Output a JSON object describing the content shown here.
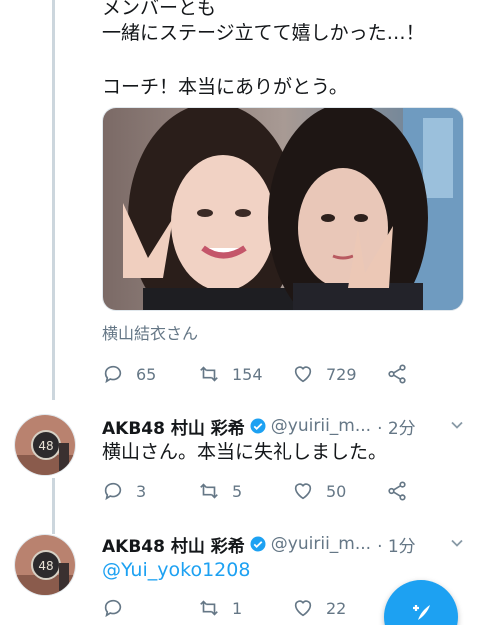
{
  "main_tweet": {
    "lines": [
      "メンバーとも",
      "一緒にステージ立てて嬉しかった…！",
      "",
      "コーチ！本当にありがとう。"
    ],
    "photo_tag": "横山結衣さん",
    "counts": {
      "reply": "65",
      "retweet": "154",
      "like": "729"
    }
  },
  "reply1": {
    "name": "AKB48 村山 彩希",
    "handle": "@yuirii_m...",
    "time": "· 2分",
    "text": "横山さん。本当に失礼しました。",
    "counts": {
      "reply": "3",
      "retweet": "5",
      "like": "50"
    }
  },
  "reply2": {
    "name": "AKB48 村山 彩希",
    "handle": "@yuirii_m...",
    "time": "· 1分",
    "text": "@Yui_yoko1208",
    "counts": {
      "reply": "",
      "retweet": "1",
      "like": "22"
    }
  },
  "colors": {
    "accent": "#1da1f2",
    "muted": "#657786",
    "thread": "#ccd6dd"
  },
  "icons": [
    "reply-icon",
    "retweet-icon",
    "like-icon",
    "share-icon",
    "verified-badge-icon",
    "chevron-down-icon",
    "compose-icon"
  ]
}
